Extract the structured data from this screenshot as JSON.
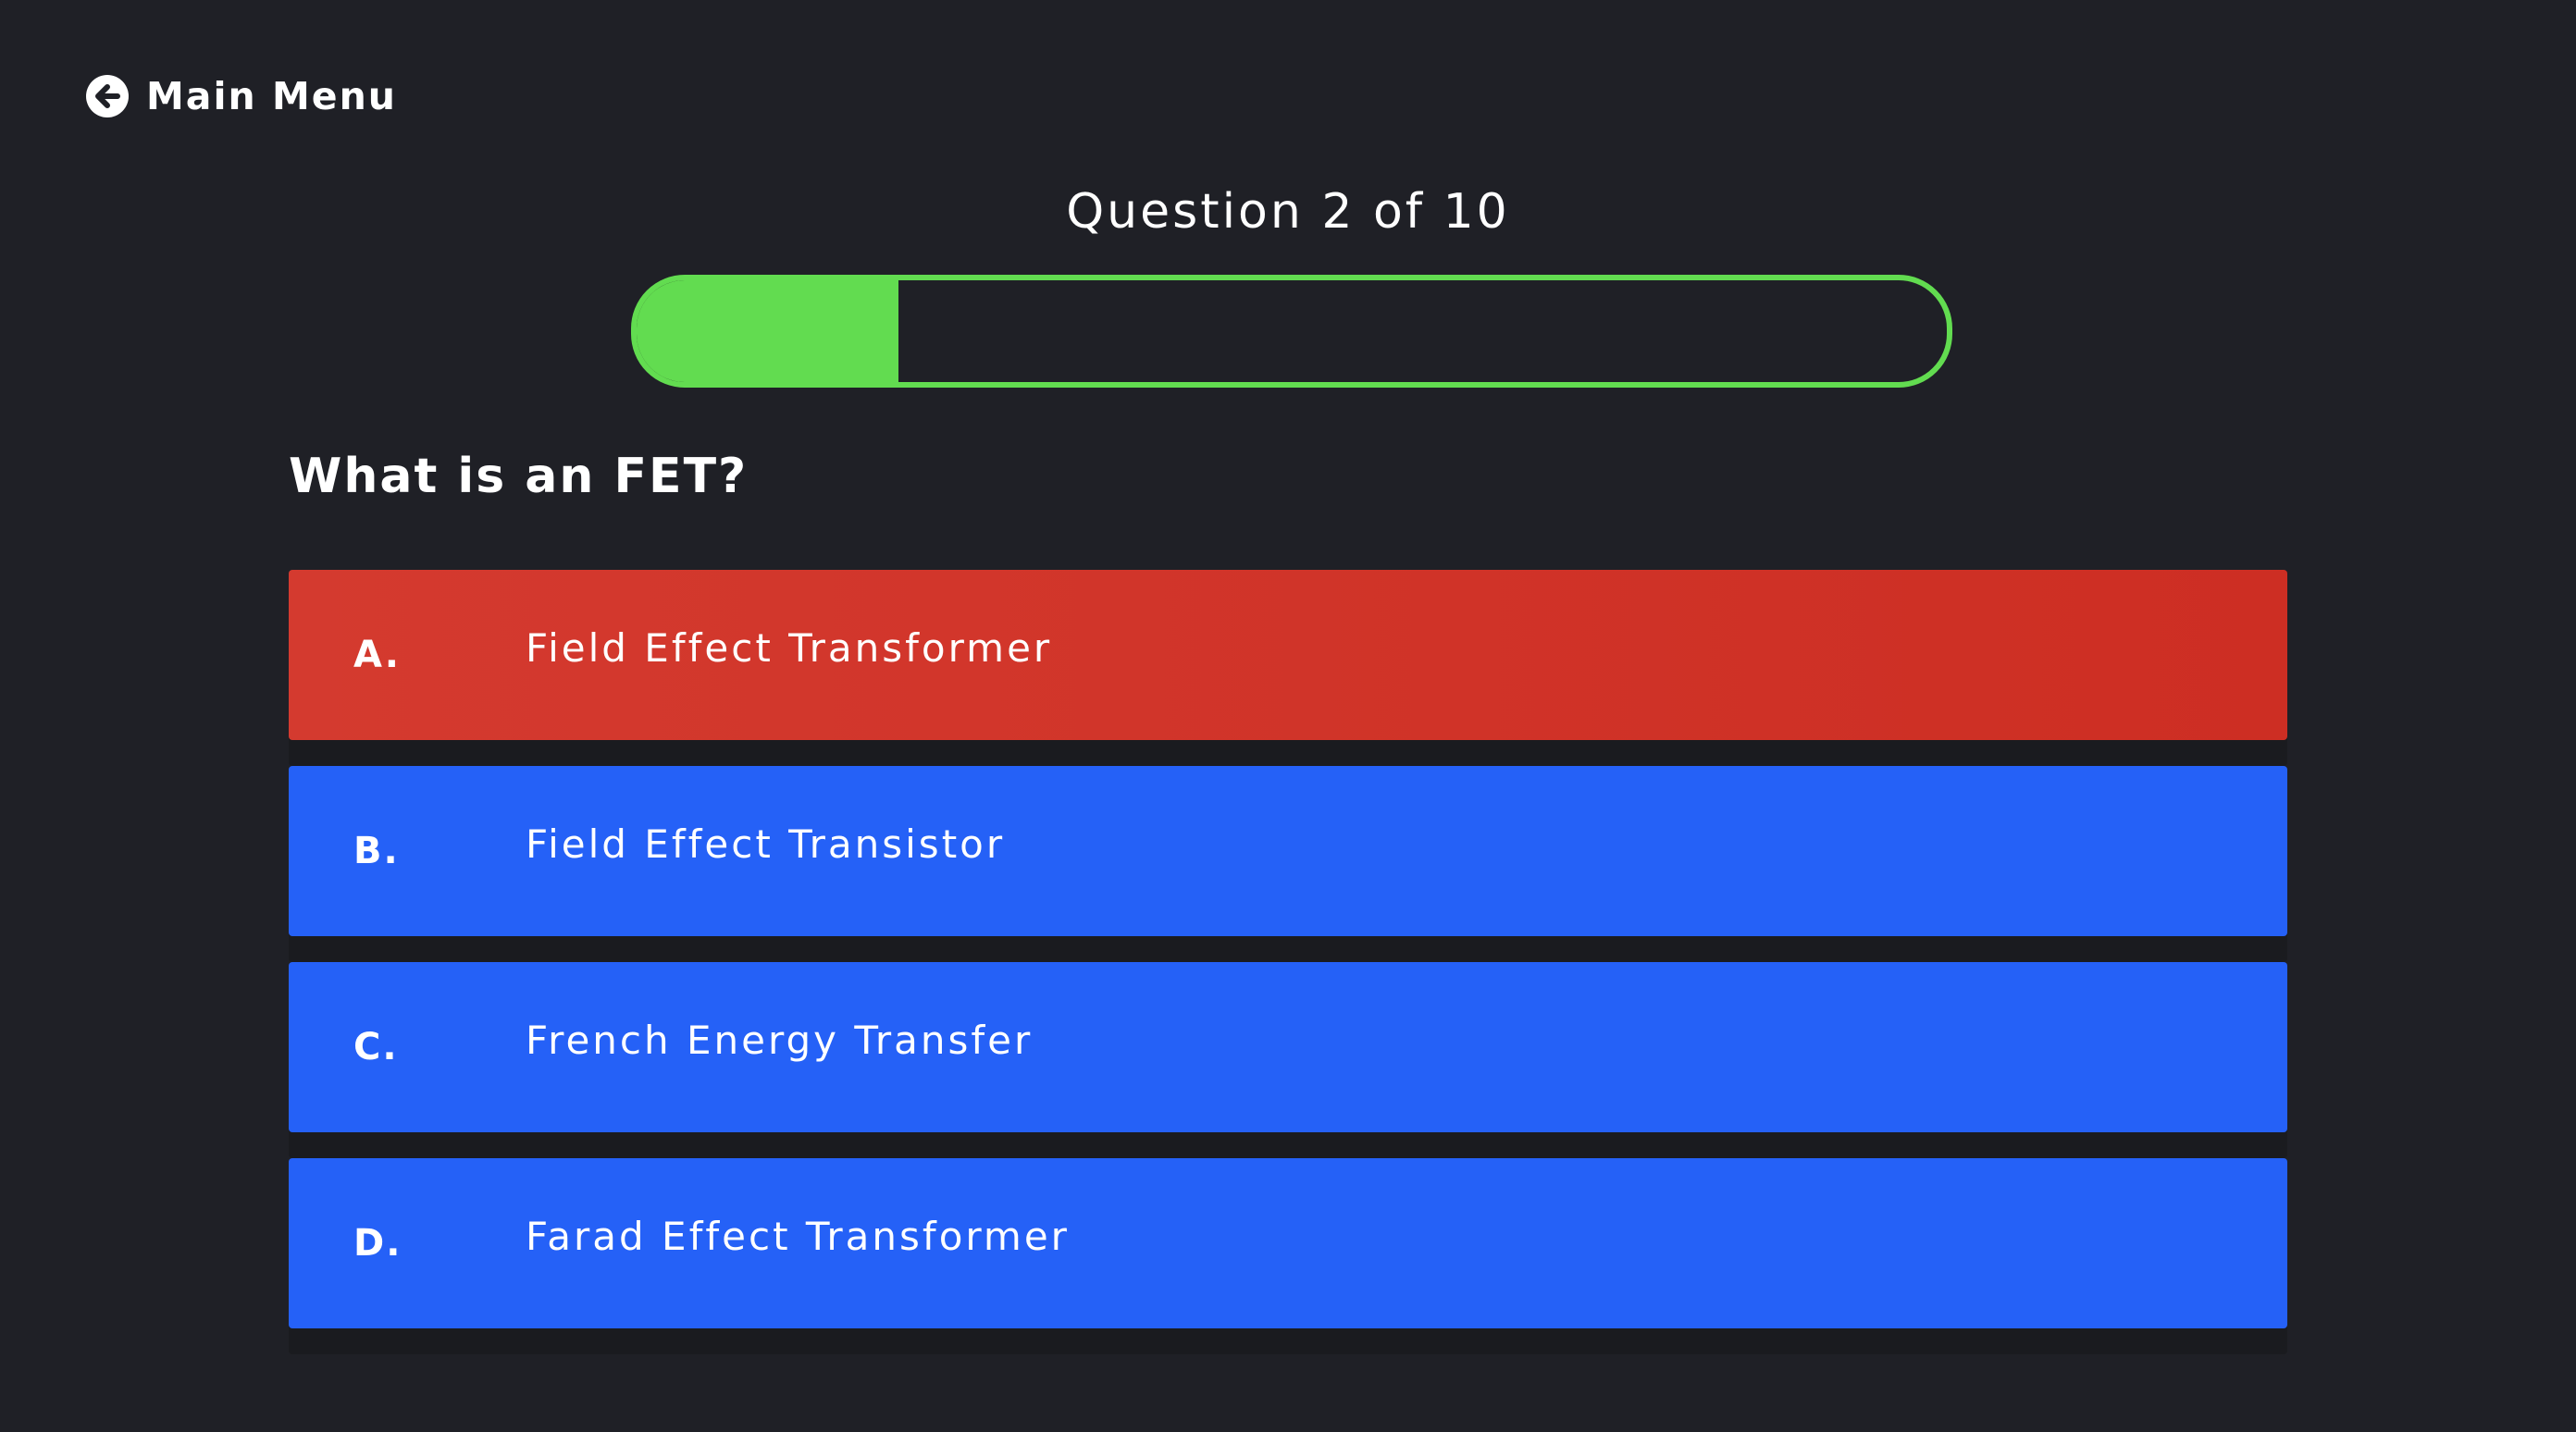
{
  "nav": {
    "back_label": "Main Menu",
    "back_icon": "arrow-left-circle-icon"
  },
  "quiz": {
    "counter_text": "Question 2 of 10",
    "progress_fraction": 0.2,
    "question": "What is an FET?",
    "answers": [
      {
        "letter": "A.",
        "text": "Field Effect Transformer",
        "state": "incorrect"
      },
      {
        "letter": "B.",
        "text": "Field Effect Transistor",
        "state": "default"
      },
      {
        "letter": "C.",
        "text": "French Energy Transfer",
        "state": "default"
      },
      {
        "letter": "D.",
        "text": "Farad Effect Transformer",
        "state": "default"
      }
    ]
  },
  "colors": {
    "background": "#1f2026",
    "progress": "#62dc50",
    "answer_default": "#2561f7",
    "answer_incorrect": "#d43a2f"
  }
}
